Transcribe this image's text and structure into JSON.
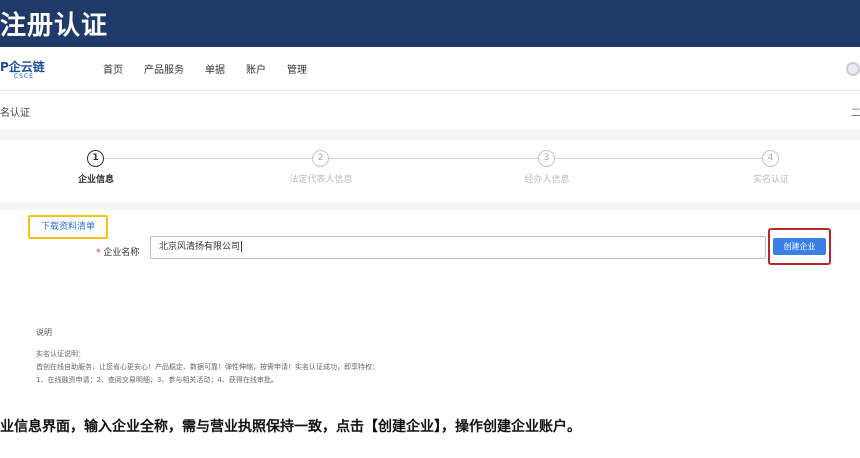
{
  "banner": {
    "title": "注册认证"
  },
  "header": {
    "logo_text": "P企云链",
    "logo_sub": "CSCE",
    "nav": [
      "首页",
      "产品服务",
      "单据",
      "账户",
      "管理"
    ]
  },
  "page": {
    "title": "名认证",
    "right_text": "二"
  },
  "steps": [
    {
      "num": "1",
      "label": "企业信息",
      "active": true
    },
    {
      "num": "2",
      "label": "法定代表人信息",
      "active": false
    },
    {
      "num": "3",
      "label": "经办人信息",
      "active": false
    },
    {
      "num": "4",
      "label": "实名认证",
      "active": false
    }
  ],
  "form": {
    "download_label": "下载资料清单",
    "required_mark": "*",
    "company_label": "企业名称",
    "company_value": "北京风清扬有限公司",
    "create_label": "创建企业"
  },
  "desc": {
    "title": "说明",
    "lines": [
      "实名认证说明：",
      "首创在线自助服务，让您省心更安心！产品稳定、数据可靠！弹性伸缩，按需申请！实名认证成功，即享特权：",
      "1、在线融资申请；2、查阅交易明细；3、参与相关活动；4、获得在线审批。"
    ]
  },
  "caption": {
    "text": "业信息界面，输入企业全称，需与营业执照保持一致，点击【创建企业】，操作创建企业账户。"
  },
  "colors": {
    "banner": "#1f3a68",
    "accent": "#3a7ee8",
    "highlight_yellow": "#f0c419",
    "highlight_red": "#b8262c"
  }
}
